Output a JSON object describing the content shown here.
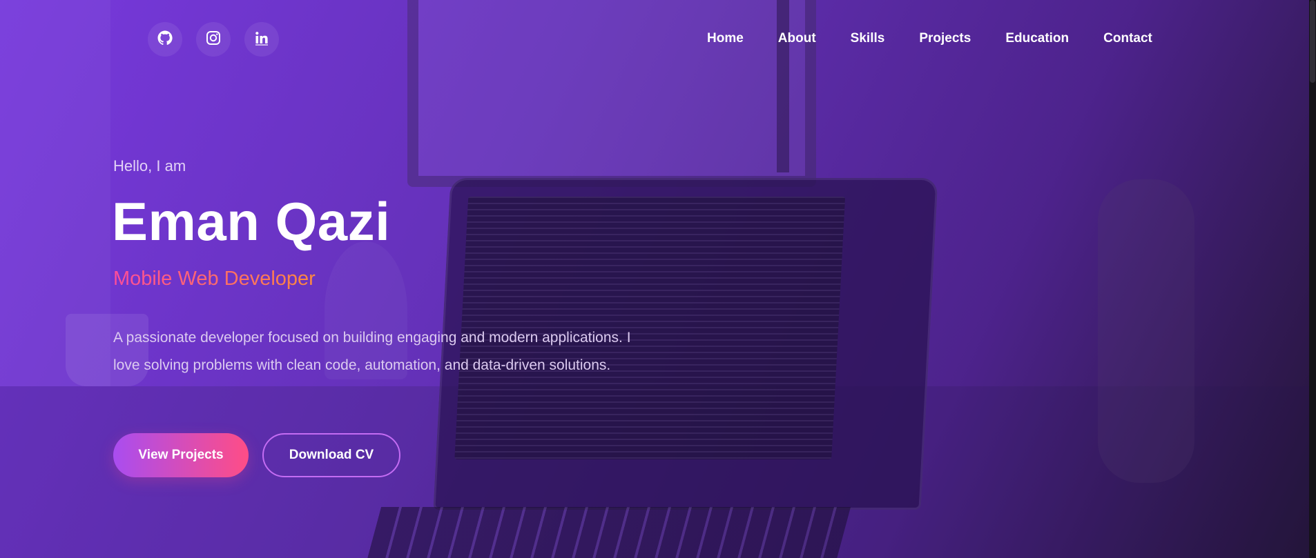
{
  "social": [
    {
      "icon": "github-icon",
      "label": "GitHub"
    },
    {
      "icon": "instagram-icon",
      "label": "Instagram"
    },
    {
      "icon": "linkedin-icon",
      "label": "LinkedIn"
    }
  ],
  "nav": {
    "items": [
      "Home",
      "About",
      "Skills",
      "Projects",
      "Education",
      "Contact"
    ]
  },
  "hero": {
    "greeting": "Hello, I am",
    "name": "Eman Qazi",
    "role": "Mobile Web Developer",
    "description": "A passionate developer focused on building engaging and modern applications. I love solving problems with clean code, automation, and data-driven solutions.",
    "primary_button": "View Projects",
    "secondary_button": "Download CV"
  },
  "colors": {
    "accent_gradient_start": "#a94df0",
    "accent_gradient_end": "#ff4d86",
    "role_gradient_start": "#ff4d9a",
    "role_gradient_end": "#ff8a3d",
    "overlay": "#7a3ae2"
  }
}
